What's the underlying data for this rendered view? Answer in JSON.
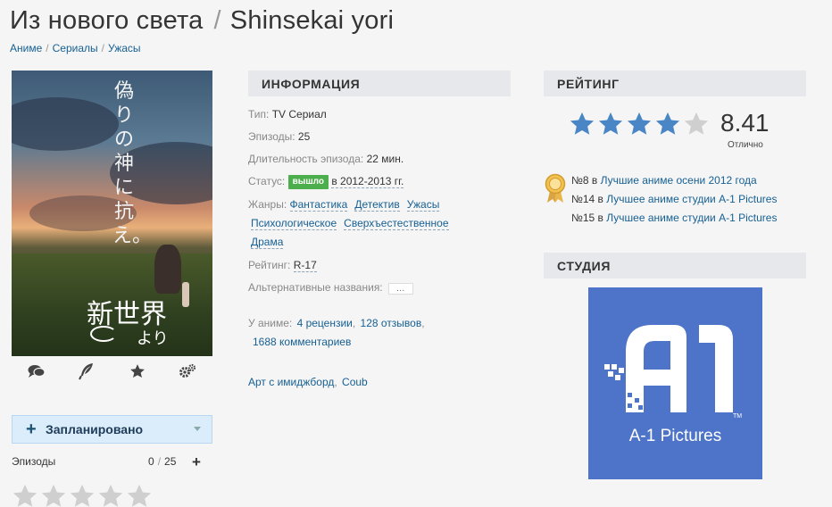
{
  "header": {
    "title_ru": "Из нового света",
    "separator": "/",
    "title_jp": "Shinsekai yori"
  },
  "breadcrumbs": [
    {
      "label": "Аниме"
    },
    {
      "label": "Сериалы"
    },
    {
      "label": "Ужасы"
    }
  ],
  "breadcrumb_separator": "/",
  "poster": {
    "vertical_text": "偽りの神に抗え。",
    "logo_text": "新世界",
    "logo_sub": "より"
  },
  "poster_actions": [
    {
      "icon": "comments-icon"
    },
    {
      "icon": "quill-icon"
    },
    {
      "icon": "star-icon"
    },
    {
      "icon": "gears-icon"
    }
  ],
  "user_list": {
    "status_label": "Запланировано",
    "episodes_label": "Эпизоды",
    "episodes_watched": "0",
    "episodes_total": "25",
    "user_rating": 0
  },
  "info": {
    "heading": "ИНФОРМАЦИЯ",
    "type_key": "Тип:",
    "type_val": "TV Сериал",
    "episodes_key": "Эпизоды:",
    "episodes_val": "25",
    "duration_key": "Длительность эпизода:",
    "duration_val": "22 мин.",
    "status_key": "Статус:",
    "status_badge": "вышло",
    "status_val": "в 2012-2013 гг.",
    "genres_key": "Жанры:",
    "genres": [
      "Фантастика",
      "Детектив",
      "Ужасы",
      "Психологическое",
      "Сверхъестественное",
      "Драма"
    ],
    "rating_key": "Рейтинг:",
    "rating_val": "R-17",
    "alt_key": "Альтернативные названия:",
    "alt_more": "…",
    "in_anime_key": "У аниме:",
    "reviews": "4 рецензии",
    "comments": "128 отзывов",
    "comments2": "1688 комментариев",
    "art_link": "Арт с имиджборд",
    "coub_link": "Coub"
  },
  "rating": {
    "heading": "РЕЙТИНГ",
    "score": "8.41",
    "score_value": 8.41,
    "stars_filled": 4,
    "stars_total": 5,
    "word": "Отлично",
    "ranks": [
      {
        "num": "№8 в",
        "link": "Лучшие аниме осени 2012 года"
      },
      {
        "num": "№14 в",
        "link": "Лучшее аниме студии A-1 Pictures"
      },
      {
        "num": "№15 в",
        "link": "Лучшее аниме студии A-1 Pictures"
      }
    ]
  },
  "studio": {
    "heading": "СТУДИЯ",
    "name": "A-1 Pictures",
    "tm": "TM",
    "brand_color": "#4e74c9"
  },
  "colors": {
    "accent": "#176093",
    "status_badge": "#4cae4c",
    "star_filled": "#4a86c5",
    "star_empty": "#cfcfcf"
  }
}
